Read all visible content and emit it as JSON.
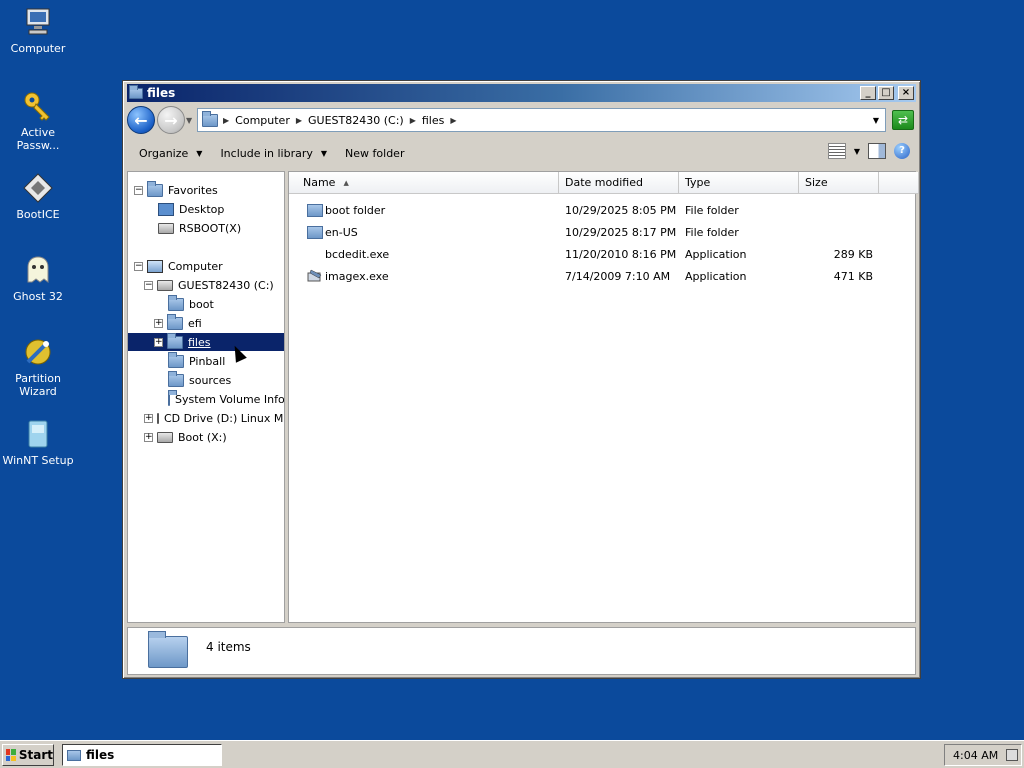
{
  "desktop": {
    "icons": [
      {
        "label_line1": "Computer",
        "label_line2": "",
        "icon": "computer-icon"
      },
      {
        "label_line1": "Active",
        "label_line2": "Passw...",
        "icon": "key-icon"
      },
      {
        "label_line1": "BootICE",
        "label_line2": "",
        "icon": "bootice-icon"
      },
      {
        "label_line1": "Ghost 32",
        "label_line2": "",
        "icon": "ghost-icon"
      },
      {
        "label_line1": "Partition",
        "label_line2": "Wizard",
        "icon": "partition-wizard-icon"
      },
      {
        "label_line1": "WinNT Setup",
        "label_line2": "",
        "icon": "winnt-setup-icon"
      }
    ]
  },
  "window": {
    "title": "files",
    "address": {
      "crumbs": [
        "Computer",
        "GUEST82430 (C:)",
        "files"
      ]
    },
    "toolbar": {
      "organize": "Organize",
      "include_in_library": "Include in library",
      "new_folder": "New folder"
    },
    "nav": {
      "favorites": "Favorites",
      "desktop": "Desktop",
      "rsboot": "RSBOOT(X)",
      "computer": "Computer",
      "drive_c": "GUEST82430 (C:)",
      "boot": "boot",
      "efi": "efi",
      "files": "files",
      "pinball": "Pinball",
      "sources": "sources",
      "system_volume": "System Volume Infor",
      "cd_drive": "CD Drive (D:) Linux Mi",
      "boot_x": "Boot (X:)"
    },
    "columns": {
      "name": "Name",
      "date_modified": "Date modified",
      "type": "Type",
      "size": "Size"
    },
    "files": [
      {
        "name": "boot folder",
        "date": "10/29/2025 8:05 PM",
        "type": "File folder",
        "size": "",
        "icon": "folder-icon"
      },
      {
        "name": "en-US",
        "date": "10/29/2025 8:17 PM",
        "type": "File folder",
        "size": "",
        "icon": "folder-icon"
      },
      {
        "name": "bcdedit.exe",
        "date": "11/20/2010 8:16 PM",
        "type": "Application",
        "size": "289 KB",
        "icon": "blank-app-icon"
      },
      {
        "name": "imagex.exe",
        "date": "7/14/2009 7:10 AM",
        "type": "Application",
        "size": "471 KB",
        "icon": "imagex-app-icon"
      }
    ],
    "details": {
      "count": "4 items"
    }
  },
  "taskbar": {
    "start": "Start",
    "task_title": "files",
    "clock": "4:04 AM"
  },
  "colors": {
    "desktop": "#0b4a9c",
    "selection": "#0a246a",
    "chrome": "#d4d0c8"
  }
}
